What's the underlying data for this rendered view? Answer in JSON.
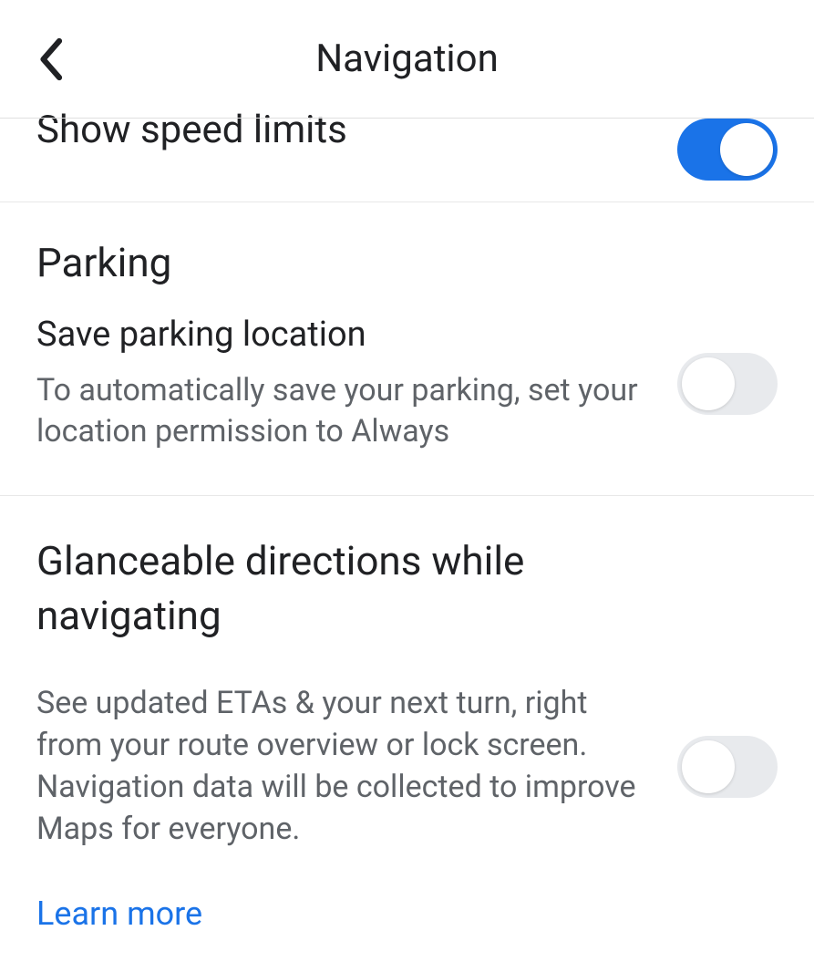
{
  "header": {
    "title": "Navigation"
  },
  "speed_limits": {
    "label": "Show speed limits",
    "enabled": true
  },
  "parking": {
    "section_title": "Parking",
    "save_label": "Save parking location",
    "save_description": "To automatically save your parking, set your location permission to Always",
    "enabled": false
  },
  "glanceable": {
    "section_title": "Glanceable directions while navigating",
    "description": "See updated ETAs & your next turn, right from your route overview or lock screen. Navigation data will be collected to improve Maps for everyone.",
    "learn_more": "Learn more",
    "enabled": false
  }
}
